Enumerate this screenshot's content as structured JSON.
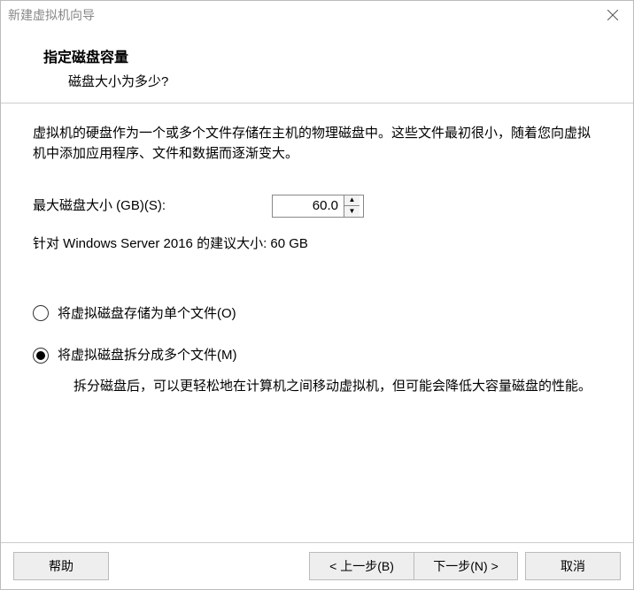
{
  "window": {
    "title": "新建虚拟机向导"
  },
  "header": {
    "title": "指定磁盘容量",
    "sub": "磁盘大小为多少?"
  },
  "body": {
    "desc": "虚拟机的硬盘作为一个或多个文件存储在主机的物理磁盘中。这些文件最初很小，随着您向虚拟机中添加应用程序、文件和数据而逐渐变大。",
    "size_label": "最大磁盘大小 (GB)(S):",
    "size_value": "60.0",
    "suggest": "针对 Windows Server 2016 的建议大小: 60 GB",
    "radio1": "将虚拟磁盘存储为单个文件(O)",
    "radio2": "将虚拟磁盘拆分成多个文件(M)",
    "radio2_help": "拆分磁盘后，可以更轻松地在计算机之间移动虚拟机，但可能会降低大容量磁盘的性能。"
  },
  "footer": {
    "help": "帮助",
    "back": "< 上一步(B)",
    "next": "下一步(N) >",
    "cancel": "取消"
  }
}
